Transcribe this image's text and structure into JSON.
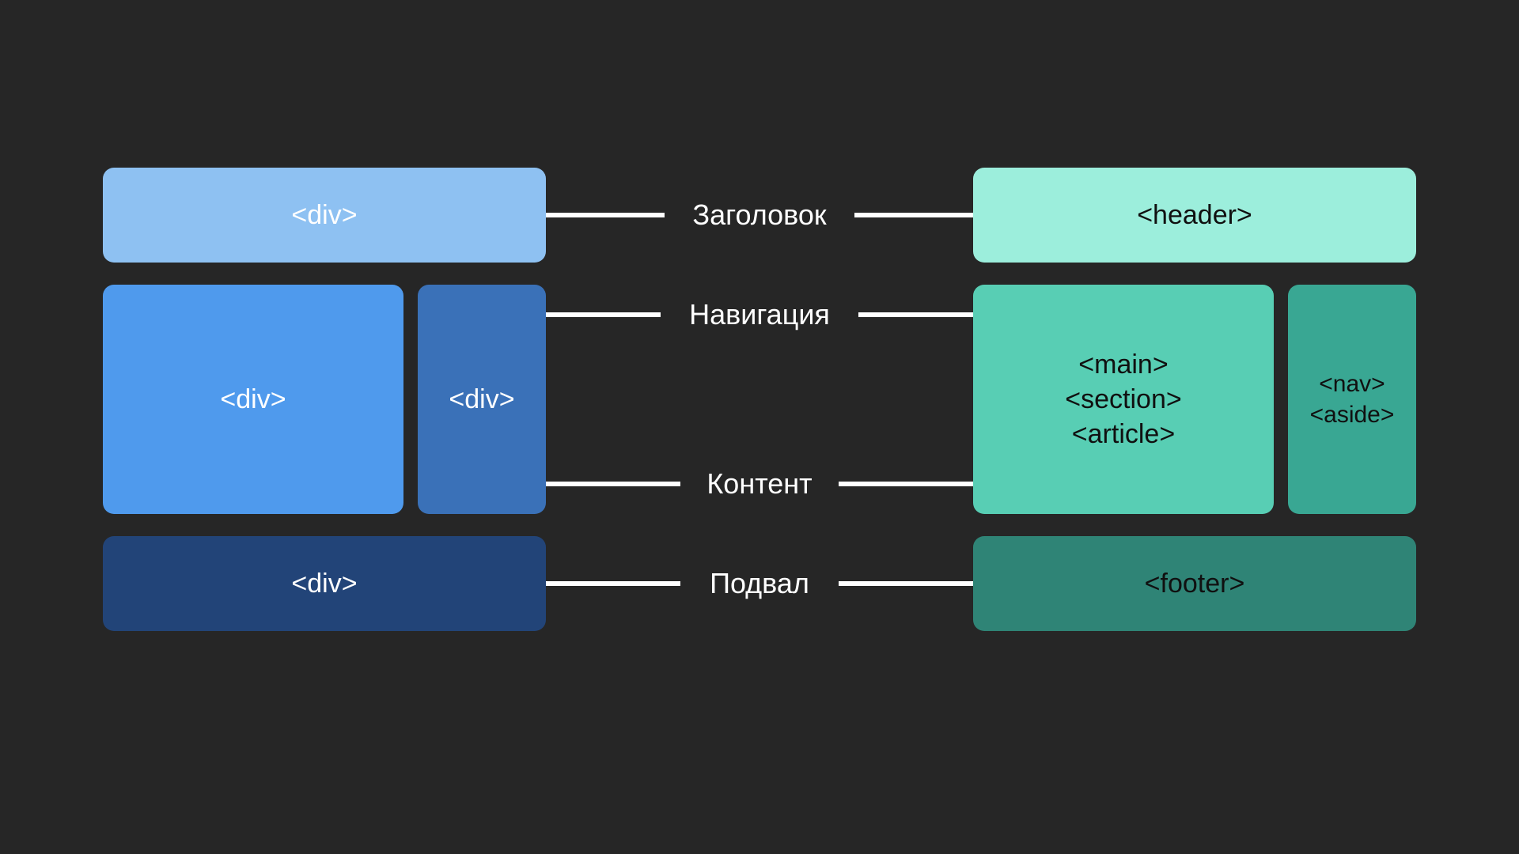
{
  "left": {
    "header": "<div>",
    "main": "<div>",
    "side": "<div>",
    "footer": "<div>"
  },
  "right": {
    "header": "<header>",
    "main": "<main>\n<section>\n<article>",
    "side": "<nav>\n<aside>",
    "footer": "<footer>"
  },
  "labels": {
    "header": "Заголовок",
    "nav": "Навигация",
    "content": "Контент",
    "footer": "Подвал"
  },
  "colors": {
    "bg": "#262626",
    "left_header": "#8ec1f2",
    "left_main": "#4f9aed",
    "left_side": "#3a71b8",
    "left_footer": "#224478",
    "right_header": "#9ceedc",
    "right_main": "#58ceb4",
    "right_side": "#39a793",
    "right_footer": "#2f8476",
    "connector": "#ffffff"
  }
}
